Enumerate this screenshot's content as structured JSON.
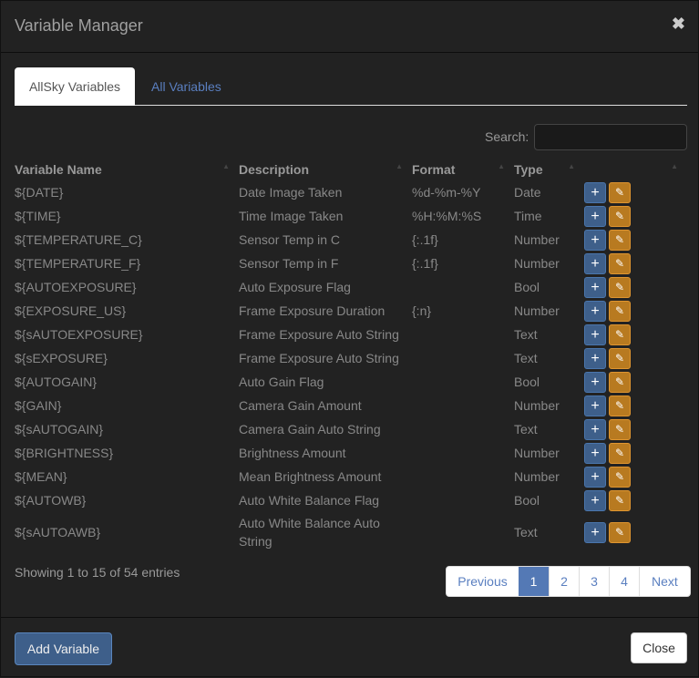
{
  "title": "Variable Manager",
  "tabs": [
    "AllSky Variables",
    "All Variables"
  ],
  "search": {
    "label": "Search:",
    "value": ""
  },
  "columns": [
    "Variable Name",
    "Description",
    "Format",
    "Type"
  ],
  "rows": [
    [
      "${DATE}",
      "Date Image Taken",
      "%d-%m-%Y",
      "Date"
    ],
    [
      "${TIME}",
      "Time Image Taken",
      "%H:%M:%S",
      "Time"
    ],
    [
      "${TEMPERATURE_C}",
      "Sensor Temp in C",
      "{:.1f}",
      "Number"
    ],
    [
      "${TEMPERATURE_F}",
      "Sensor Temp in F",
      "{:.1f}",
      "Number"
    ],
    [
      "${AUTOEXPOSURE}",
      "Auto Exposure Flag",
      "",
      "Bool"
    ],
    [
      "${EXPOSURE_US}",
      "Frame Exposure Duration",
      "{:n}",
      "Number"
    ],
    [
      "${sAUTOEXPOSURE}",
      "Frame Exposure Auto String",
      "",
      "Text"
    ],
    [
      "${sEXPOSURE}",
      "Frame Exposure Auto String",
      "",
      "Text"
    ],
    [
      "${AUTOGAIN}",
      "Auto Gain Flag",
      "",
      "Bool"
    ],
    [
      "${GAIN}",
      "Camera Gain Amount",
      "",
      "Number"
    ],
    [
      "${sAUTOGAIN}",
      "Camera Gain Auto String",
      "",
      "Text"
    ],
    [
      "${BRIGHTNESS}",
      "Brightness Amount",
      "",
      "Number"
    ],
    [
      "${MEAN}",
      "Mean Brightness Amount",
      "",
      "Number"
    ],
    [
      "${AUTOWB}",
      "Auto White Balance Flag",
      "",
      "Bool"
    ],
    [
      "${sAUTOAWB}",
      "Auto White Balance Auto String",
      "",
      "Text"
    ]
  ],
  "info": "Showing 1 to 15 of 54 entries",
  "pagination": {
    "previous": "Previous",
    "pages": [
      "1",
      "2",
      "3",
      "4"
    ],
    "current": "1",
    "next": "Next"
  },
  "footer": {
    "add": "Add Variable",
    "close": "Close"
  },
  "icons": {
    "close": "times-icon",
    "add": "plus-icon",
    "edit": "edit-icon"
  },
  "colors": {
    "add": "#3e5f8a",
    "edit": "#b87a20",
    "active_page": "#5479b5"
  }
}
